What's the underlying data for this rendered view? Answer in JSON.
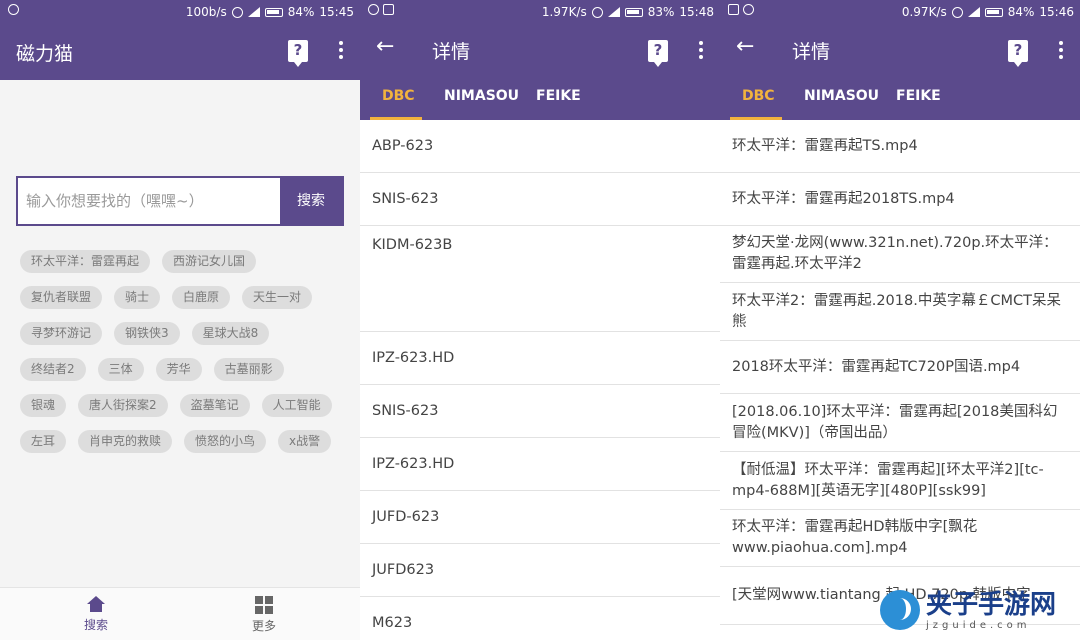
{
  "panel_search": {
    "status": {
      "speed": "100b/s",
      "battery": "84%",
      "time": "15:45"
    },
    "title": "磁力猫",
    "search": {
      "placeholder": "输入你想要找的（嘿嘿~）",
      "button": "搜索"
    },
    "tags": [
      [
        "环太平洋：雷霆再起",
        "西游记女儿国"
      ],
      [
        "复仇者联盟",
        "骑士",
        "白鹿原",
        "天生一对"
      ],
      [
        "寻梦环游记",
        "钢铁侠3",
        "星球大战8"
      ],
      [
        "终结者2",
        "三体",
        "芳华",
        "古墓丽影"
      ],
      [
        "银魂",
        "唐人街探案2",
        "盗墓笔记",
        "人工智能"
      ],
      [
        "左耳",
        "肖申克的救赎",
        "愤怒的小鸟",
        "x战警"
      ]
    ],
    "nav": {
      "search": "搜索",
      "more": "更多"
    }
  },
  "panel_detail_a": {
    "status": {
      "speed": "1.97K/s",
      "battery": "83%",
      "time": "15:48"
    },
    "title": "详情",
    "tabs": [
      "DBC",
      "NIMASOU",
      "FEIKE"
    ],
    "results": [
      "ABP-623",
      "SNIS-623",
      "KIDM-623B",
      "IPZ-623.HD",
      "SNIS-623",
      "IPZ-623.HD",
      "JUFD-623",
      "JUFD623",
      "M623"
    ]
  },
  "panel_detail_b": {
    "status": {
      "speed": "0.97K/s",
      "battery": "84%",
      "time": "15:46"
    },
    "title": "详情",
    "tabs": [
      "DBC",
      "NIMASOU",
      "FEIKE"
    ],
    "results": [
      "环太平洋：雷霆再起TS.mp4",
      "环太平洋：雷霆再起2018TS.mp4",
      "梦幻天堂·龙网(www.321n.net).720p.环太平洋：雷霆再起.环太平洋2",
      "环太平洋2：雷霆再起.2018.中英字幕￡CMCT呆呆熊",
      "2018环太平洋：雷霆再起TC720P国语.mp4",
      "[2018.06.10]环太平洋：雷霆再起[2018美国科幻冒险(MKV)]（帝国出品）",
      "【耐低温】环太平洋：雷霆再起][环太平洋2][tc-mp4-688M][英语无字][480P][ssk99]",
      "环太平洋：雷霆再起HD韩版中字[飘花www.piaohua.com].mp4",
      "[天堂网www.tiantang 起.HD.720p.韩版中字"
    ]
  },
  "watermark": {
    "main": "夹子手游网",
    "sub": "jzguide.com"
  },
  "colors": {
    "primary": "#5b4a8c",
    "accent": "#f2b33d",
    "chip_bg": "#dddddd"
  }
}
